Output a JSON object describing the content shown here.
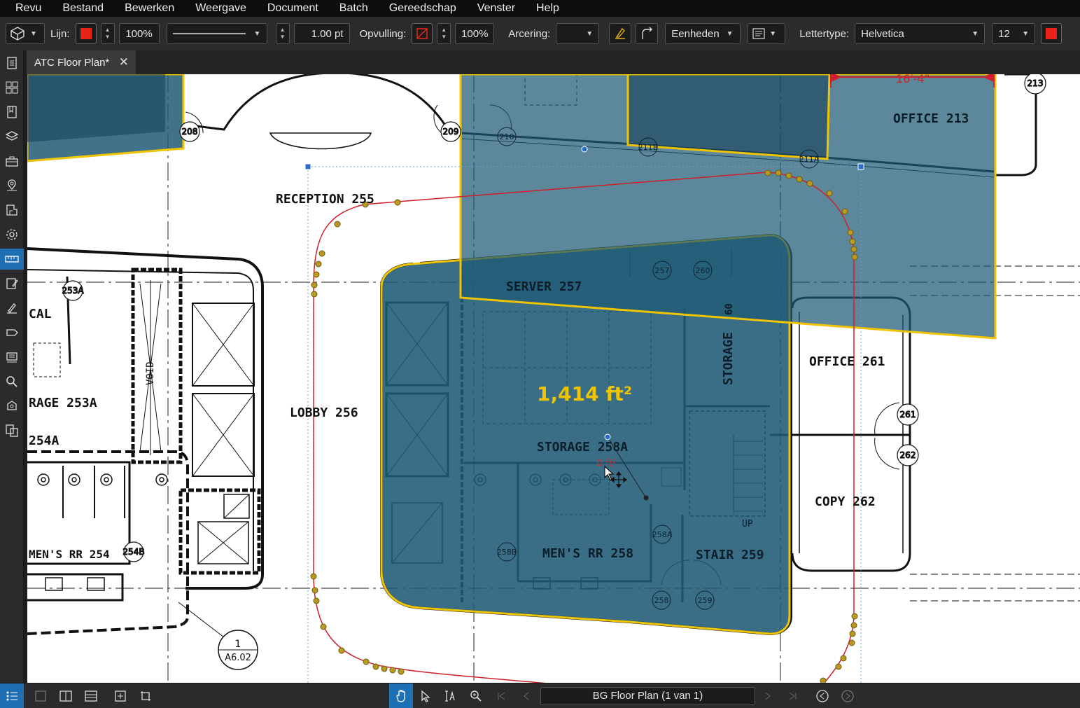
{
  "menu": [
    "Revu",
    "Bestand",
    "Bewerken",
    "Weergave",
    "Document",
    "Batch",
    "Gereedschap",
    "Venster",
    "Help"
  ],
  "toolbar": {
    "line_label": "Lijn:",
    "line_color": "#e8231b",
    "line_opacity": "100%",
    "line_width": "1.00 pt",
    "fill_label": "Opvulling:",
    "fill_opacity": "100%",
    "hatch_label": "Arcering:",
    "units": "Eenheden",
    "font_label": "Lettertype:",
    "font_name": "Helvetica",
    "font_size": "12",
    "text_color": "#e8231b"
  },
  "tab": {
    "title": "ATC Floor Plan*"
  },
  "drawing": {
    "area_measurement": "1,414 ft²",
    "small_measurement": "0 ft²",
    "dimension": "16'-4\"",
    "rooms": {
      "reception": "RECEPTION  255",
      "lobby": "LOBBY  256",
      "office213": "OFFICE  213",
      "server": "SERVER  257",
      "storage258a": "STORAGE  258A",
      "storage260": "STORAGE",
      "office261": "OFFICE  261",
      "copy262": "COPY  262",
      "mensrr258": "MEN'S RR  258",
      "stair259": "STAIR  259",
      "storage253a": "RAGE 253A",
      "r254a": "254A",
      "mensrr254": "MEN'S RR  254",
      "cal": "CAL",
      "void": "VOID",
      "up": "UP"
    },
    "tags": {
      "t208": "208",
      "t209": "209",
      "t210": "210",
      "t211b": "211B",
      "t211a": "211A",
      "t213": "213",
      "t253a": "253A",
      "t254b": "254B",
      "t257": "257",
      "t260": "260",
      "t258a": "258A",
      "t258b": "258B",
      "t258": "258",
      "t259": "259",
      "t261": "261",
      "t262": "262",
      "t60": "60"
    },
    "section_marker": {
      "number": "1",
      "sheet": "A6.02"
    }
  },
  "status": {
    "page_label": "BG Floor Plan (1 van 1)"
  },
  "colors": {
    "overlay_fill": "#1f5a76",
    "overlay_border": "#f0c400",
    "markup_red": "#d0202a",
    "control_point": "#b89a20",
    "handle_blue": "#2a6cc6"
  }
}
